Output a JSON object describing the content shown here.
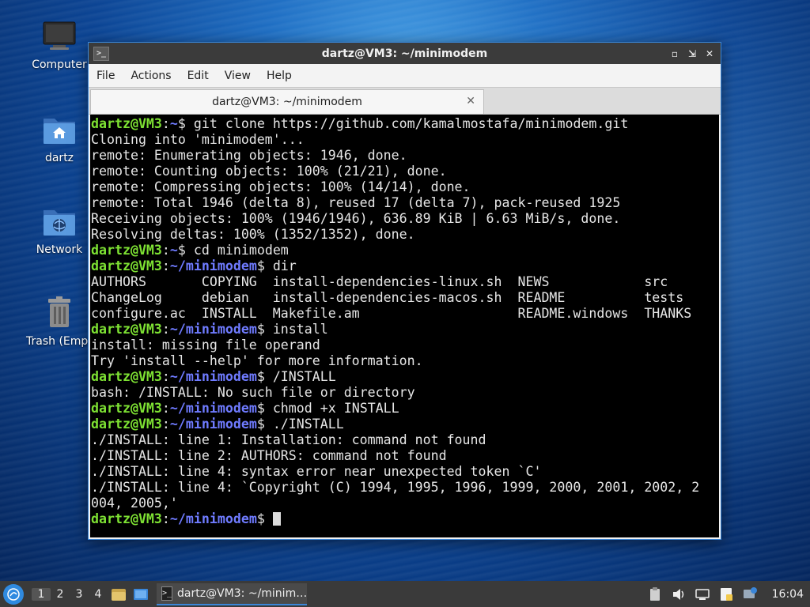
{
  "desktop": {
    "icons": [
      {
        "label": "Computer"
      },
      {
        "label": "dartz"
      },
      {
        "label": "Network"
      },
      {
        "label": "Trash (Empty)"
      }
    ]
  },
  "window": {
    "title": "dartz@VM3: ~/minimodem",
    "menu": [
      "File",
      "Actions",
      "Edit",
      "View",
      "Help"
    ],
    "tab_title": "dartz@VM3: ~/minimodem"
  },
  "terminal": {
    "prompt_user": "dartz@VM3",
    "lines": [
      {
        "path": "~",
        "cmd": " git clone https://github.com/kamalmostafa/minimodem.git"
      },
      {
        "out": "Cloning into 'minimodem'..."
      },
      {
        "out": "remote: Enumerating objects: 1946, done."
      },
      {
        "out": "remote: Counting objects: 100% (21/21), done."
      },
      {
        "out": "remote: Compressing objects: 100% (14/14), done."
      },
      {
        "out": "remote: Total 1946 (delta 8), reused 17 (delta 7), pack-reused 1925"
      },
      {
        "out": "Receiving objects: 100% (1946/1946), 636.89 KiB | 6.63 MiB/s, done."
      },
      {
        "out": "Resolving deltas: 100% (1352/1352), done."
      },
      {
        "path": "~",
        "cmd": " cd minimodem"
      },
      {
        "path": "~/minimodem",
        "cmd": " dir"
      },
      {
        "out": "AUTHORS       COPYING  install-dependencies-linux.sh  NEWS            src"
      },
      {
        "out": "ChangeLog     debian   install-dependencies-macos.sh  README          tests"
      },
      {
        "out": "configure.ac  INSTALL  Makefile.am                    README.windows  THANKS"
      },
      {
        "path": "~/minimodem",
        "cmd": " install"
      },
      {
        "out": "install: missing file operand"
      },
      {
        "out": "Try 'install --help' for more information."
      },
      {
        "path": "~/minimodem",
        "cmd": " /INSTALL"
      },
      {
        "out": "bash: /INSTALL: No such file or directory"
      },
      {
        "path": "~/minimodem",
        "cmd": " chmod +x INSTALL"
      },
      {
        "path": "~/minimodem",
        "cmd": " ./INSTALL"
      },
      {
        "out": "./INSTALL: line 1: Installation: command not found"
      },
      {
        "out": "./INSTALL: line 2: AUTHORS: command not found"
      },
      {
        "out": "./INSTALL: line 4: syntax error near unexpected token `C'"
      },
      {
        "out": "./INSTALL: line 4: `Copyright (C) 1994, 1995, 1996, 1999, 2000, 2001, 2002, 2"
      },
      {
        "out": "004, 2005,'"
      },
      {
        "path": "~/minimodem",
        "cmd": " ",
        "cursor": true
      }
    ]
  },
  "taskbar": {
    "workspaces": [
      "1",
      "2",
      "3",
      "4"
    ],
    "active_workspace": "1",
    "task_label": "dartz@VM3: ~/minim…",
    "clock": "16:04"
  },
  "colors": {
    "prompt_user": "#7ee233",
    "prompt_path": "#6f7bff",
    "accent": "#3a86d8"
  }
}
